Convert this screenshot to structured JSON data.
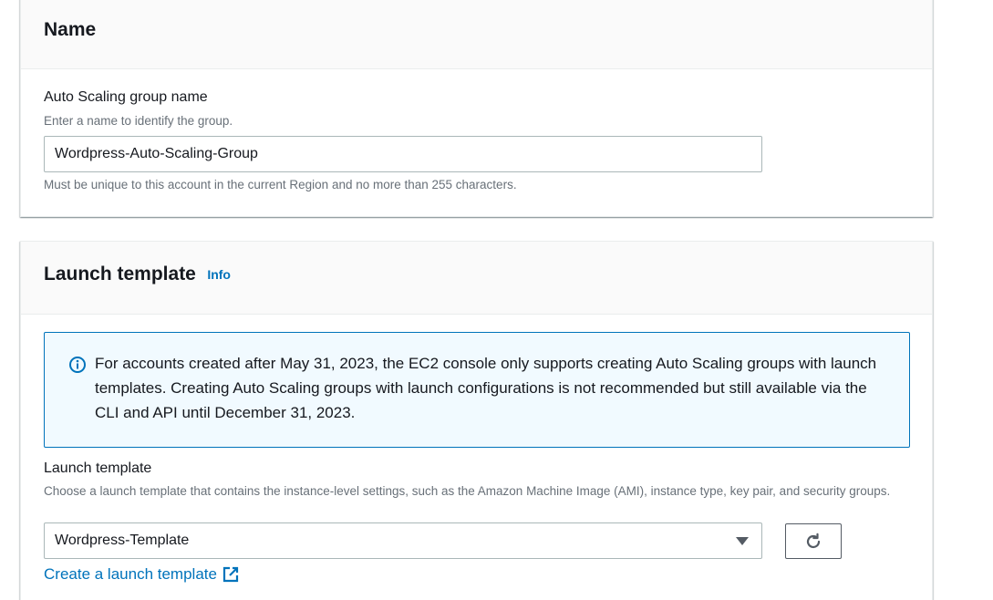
{
  "name_section": {
    "title": "Name",
    "field_label": "Auto Scaling group name",
    "field_description": "Enter a name to identify the group.",
    "field_value": "Wordpress-Auto-Scaling-Group",
    "constraint_text": "Must be unique to this account in the current Region and no more than 255 characters."
  },
  "launch_section": {
    "title": "Launch template",
    "info_link": "Info",
    "alert": {
      "icon": "info-circle-icon",
      "text": "For accounts created after May 31, 2023, the EC2 console only supports creating Auto Scaling groups with launch templates. Creating Auto Scaling groups with launch configurations is not recommended but still available via the CLI and API until December 31, 2023."
    },
    "field_label": "Launch template",
    "field_description": "Choose a launch template that contains the instance-level settings, such as the Amazon Machine Image (AMI), instance type, key pair, and security groups.",
    "selected_template": "Wordpress-Template",
    "refresh_icon": "refresh-icon",
    "create_link": "Create a launch template",
    "create_link_icon": "external-link-icon"
  },
  "colors": {
    "link": "#0073bb",
    "alert_background": "#f1faff",
    "alert_border": "#0073bb",
    "header_background": "#fafafa",
    "muted_text": "#687078"
  }
}
